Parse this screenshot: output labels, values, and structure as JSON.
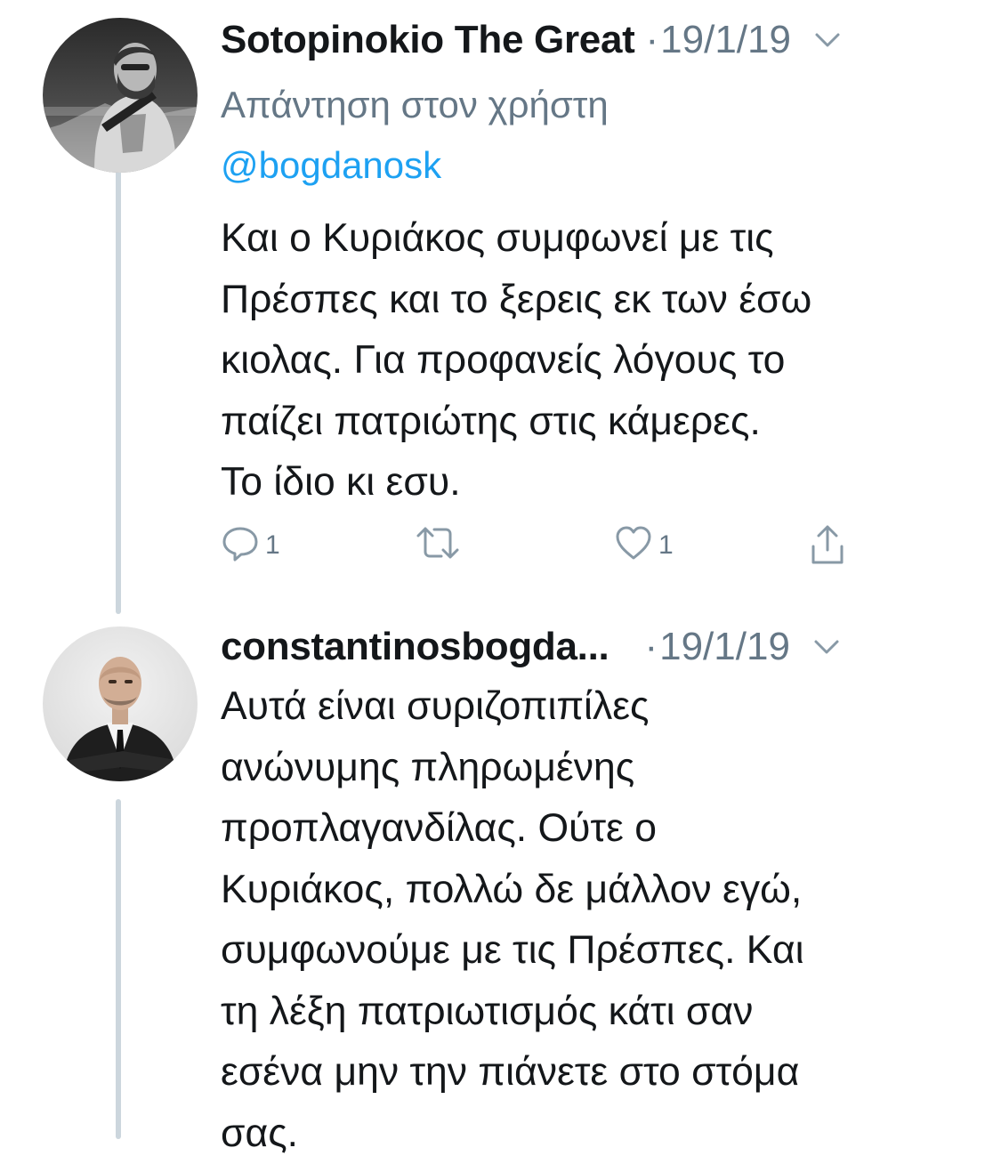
{
  "tweets": [
    {
      "author": "Sotopinokio The Great",
      "separator": "·",
      "date": "19/1/19",
      "reply_prefix": "Απάντηση στον χρήστη",
      "reply_handle": "@bogdanosk",
      "text": "Και ο Κυριάκος συμφωνεί με τις\nΠρέσπες και το ξερεις εκ των έσω\nκιολας. Για προφανείς λόγους το\nπαίζει πατριώτης στις κάμερες.\nΤο ίδιο κι εσυ.",
      "actions": {
        "reply_count": "1",
        "retweet_count": "",
        "like_count": "1"
      },
      "icons": [
        "reply-icon",
        "retweet-icon",
        "like-icon",
        "share-icon",
        "chevron-down-icon"
      ]
    },
    {
      "author": "constantinosbogda...",
      "separator": "·",
      "date": "19/1/19",
      "text": "Αυτά είναι συριζοπιπίλες\nανώνυμης πληρωμένης\nπροπλαγανδίλας. Ούτε ο\nΚυριάκος, πολλώ δε μάλλον εγώ,\nσυμφωνούμε με τις Πρέσπες. Και\nτη λέξη πατριωτισμός κάτι σαν\nεσένα μην την πιάνετε στο στόμα\nσας.",
      "icons": [
        "chevron-down-icon"
      ]
    }
  ],
  "colors": {
    "text": "#14171a",
    "secondary": "#657786",
    "link": "#1da1f2",
    "thread_line": "#ccd6dd",
    "background": "#ffffff"
  }
}
